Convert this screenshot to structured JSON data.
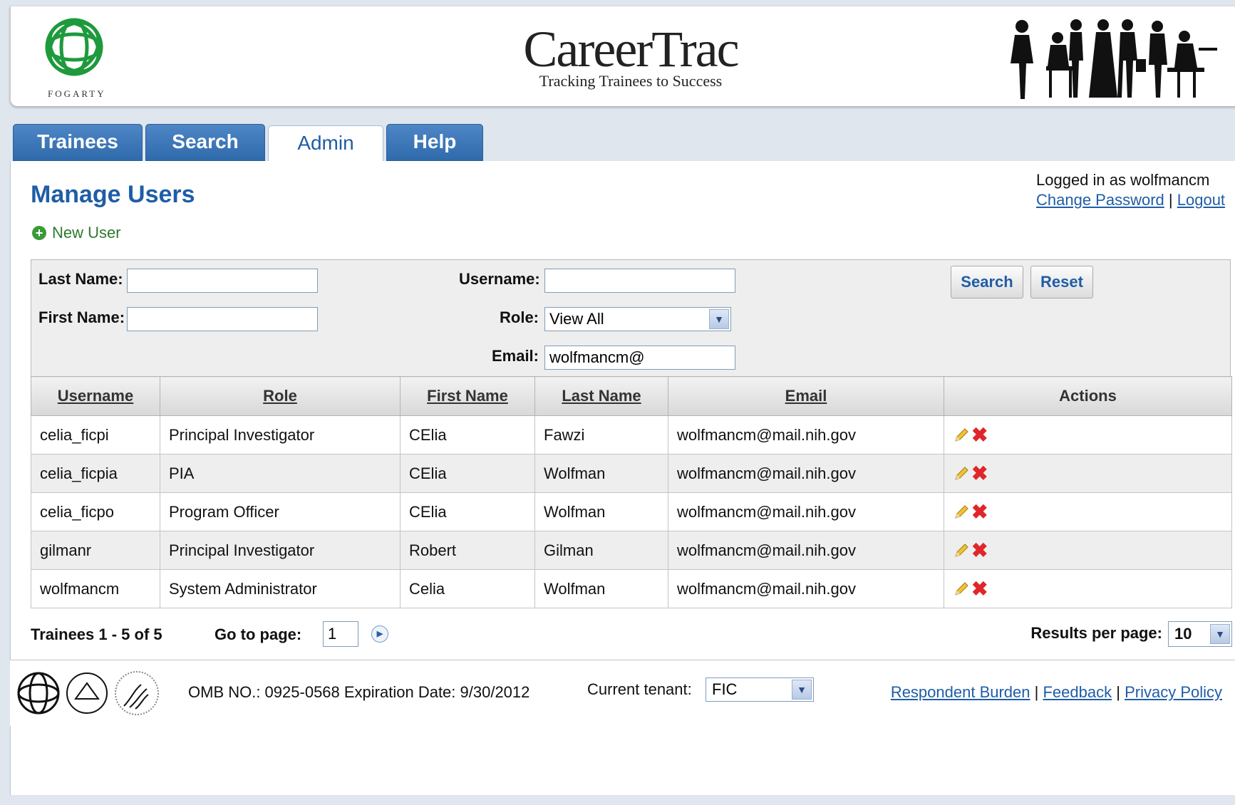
{
  "header": {
    "logo_text": "FOGARTY",
    "brand_title": "CareerTrac",
    "brand_tagline": "Tracking Trainees to Success",
    "silhouettes": "people-silhouettes-icon"
  },
  "tabs": [
    {
      "label": "Trainees",
      "active": false
    },
    {
      "label": "Search",
      "active": false
    },
    {
      "label": "Admin",
      "active": true
    },
    {
      "label": "Help",
      "active": false
    }
  ],
  "page": {
    "title": "Manage Users",
    "new_user_label": "New User"
  },
  "login": {
    "logged_in_text": "Logged in as wolfmancm",
    "change_password": "Change Password",
    "separator": "|",
    "logout": "Logout"
  },
  "filters": {
    "last_name": {
      "label": "Last Name:",
      "value": ""
    },
    "first_name": {
      "label": "First Name:",
      "value": ""
    },
    "username": {
      "label": "Username:",
      "value": ""
    },
    "role": {
      "label": "Role:",
      "value": "View All"
    },
    "email": {
      "label": "Email:",
      "value": "wolfmancm@"
    },
    "search_button": "Search",
    "reset_button": "Reset"
  },
  "table": {
    "columns": [
      "Username",
      "Role",
      "First Name",
      "Last Name",
      "Email",
      "Actions"
    ],
    "rows": [
      {
        "username": "celia_ficpi",
        "role": "Principal Investigator",
        "first_name": "CElia",
        "last_name": "Fawzi",
        "email": "wolfmancm@mail.nih.gov"
      },
      {
        "username": "celia_ficpia",
        "role": "PIA",
        "first_name": "CElia",
        "last_name": "Wolfman",
        "email": "wolfmancm@mail.nih.gov"
      },
      {
        "username": "celia_ficpo",
        "role": "Program Officer",
        "first_name": "CElia",
        "last_name": "Wolfman",
        "email": "wolfmancm@mail.nih.gov"
      },
      {
        "username": "gilmanr",
        "role": "Principal Investigator",
        "first_name": "Robert",
        "last_name": "Gilman",
        "email": "wolfmancm@mail.nih.gov"
      },
      {
        "username": "wolfmancm",
        "role": "System Administrator",
        "first_name": "Celia",
        "last_name": "Wolfman",
        "email": "wolfmancm@mail.nih.gov"
      }
    ]
  },
  "pager": {
    "count_text": "Trainees 1 - 5 of 5",
    "goto_label": "Go to page:",
    "page_value": "1",
    "results_label": "Results per page:",
    "results_value": "10"
  },
  "footer": {
    "omb_text": "OMB NO.: 0925-0568 Expiration Date: 9/30/2012",
    "tenant_label": "Current tenant:",
    "tenant_value": "FIC",
    "links": [
      "Respondent Burden",
      "Feedback",
      "Privacy Policy"
    ],
    "separator": "|"
  },
  "colors": {
    "accent": "#1f5da6",
    "tab_blue": "#3a75b8",
    "delete_red": "#e0262b",
    "new_user_green": "#2e7a2e"
  }
}
